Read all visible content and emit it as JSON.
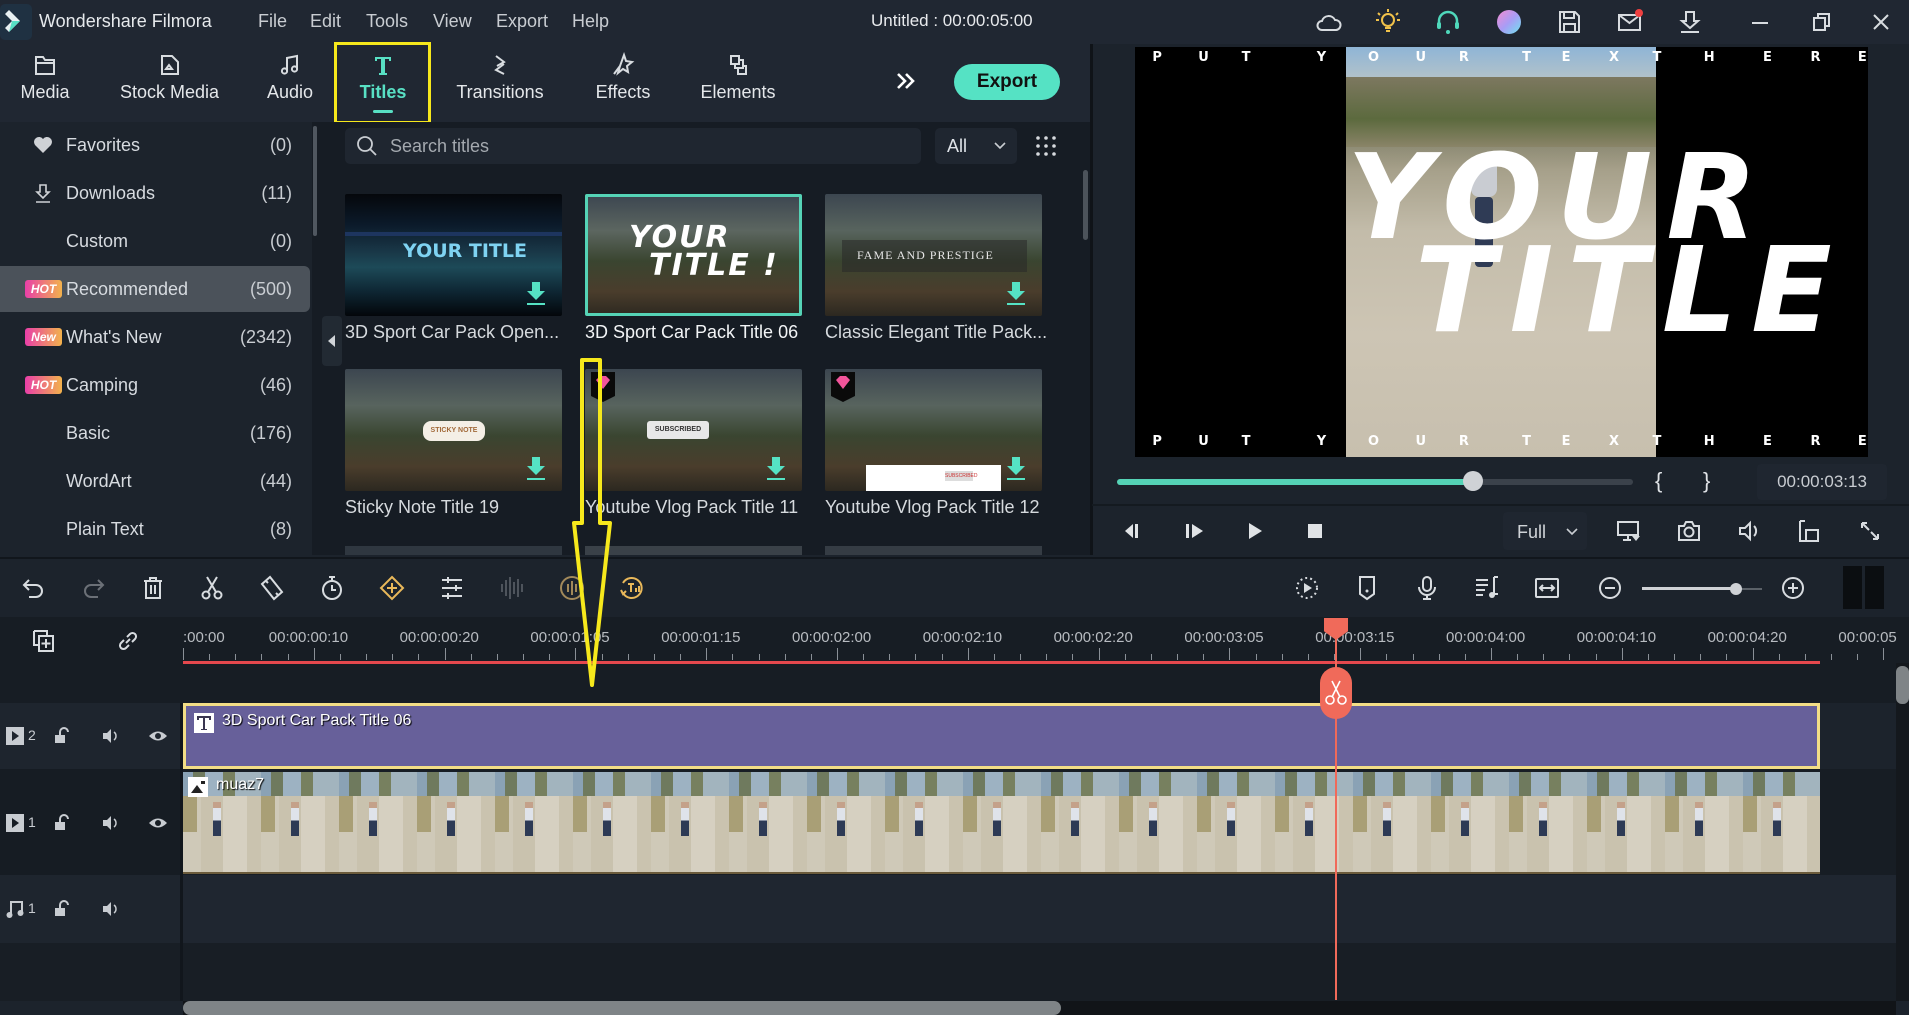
{
  "titlebar": {
    "app_name": "Wondershare Filmora",
    "menu": [
      "File",
      "Edit",
      "Tools",
      "View",
      "Export",
      "Help"
    ],
    "document_title": "Untitled : 00:00:05:00",
    "icons": [
      "cloud-icon",
      "lightbulb-icon",
      "headset-icon",
      "avatar-icon",
      "save-icon",
      "mail-icon",
      "download-icon",
      "minimize-icon",
      "restore-icon",
      "close-icon"
    ]
  },
  "tabs": [
    {
      "label": "Media",
      "icon": "folder-icon"
    },
    {
      "label": "Stock Media",
      "icon": "stock-media-icon"
    },
    {
      "label": "Audio",
      "icon": "music-note-icon"
    },
    {
      "label": "Titles",
      "icon": "text-t-icon",
      "active": true
    },
    {
      "label": "Transitions",
      "icon": "transitions-icon"
    },
    {
      "label": "Effects",
      "icon": "effects-star-icon"
    },
    {
      "label": "Elements",
      "icon": "elements-icon"
    }
  ],
  "toolbar": {
    "more_label": "»",
    "export_label": "Export"
  },
  "colors": {
    "accent": "#55e2c4",
    "highlight_box": "#f6e81c",
    "playhead": "#f06a5a",
    "title_clip": "#67609a",
    "clip_border": "#f3de86",
    "timeline_red": "#e5484d"
  },
  "sidebar": {
    "items": [
      {
        "label": "Favorites",
        "count": "(0)",
        "icon": "heart-icon"
      },
      {
        "label": "Downloads",
        "count": "(11)",
        "icon": "download-icon"
      },
      {
        "label": "Custom",
        "count": "(0)"
      },
      {
        "label": "Recommended",
        "count": "(500)",
        "badge": "HOT",
        "selected": true
      },
      {
        "label": "What's New",
        "count": "(2342)",
        "badge": "New"
      },
      {
        "label": "Camping",
        "count": "(46)",
        "badge": "HOT"
      },
      {
        "label": "Basic",
        "count": "(176)"
      },
      {
        "label": "WordArt",
        "count": "(44)"
      },
      {
        "label": "Plain Text",
        "count": "(8)"
      }
    ]
  },
  "library": {
    "search_placeholder": "Search titles",
    "filter_value": "All",
    "thumbnails": [
      {
        "label": "3D Sport Car Pack Open...",
        "overlay": "YOUR TITLE",
        "download": true
      },
      {
        "label": "3D Sport Car Pack Title 06",
        "overlay_line1": "YOUR",
        "overlay_line2": "TITLE !",
        "selected": true
      },
      {
        "label": "Classic Elegant Title Pack...",
        "overlay": "FAME AND PRESTIGE",
        "download": true
      },
      {
        "label": "Sticky Note Title 19",
        "overlay": "STICKY NOTE",
        "download": true
      },
      {
        "label": "Youtube Vlog Pack Title 11",
        "overlay": "SUBSCRIBED",
        "premium": true,
        "download": true
      },
      {
        "label": "Youtube Vlog Pack Title 12",
        "overlay": "SUBSCRIBED",
        "premium": true,
        "download": true
      }
    ]
  },
  "preview": {
    "top_text": [
      "P",
      "U",
      "T",
      "Y",
      "O",
      "U",
      "R",
      "T",
      "E",
      "X",
      "T",
      "H",
      "E",
      "R",
      "E"
    ],
    "bottom_text": [
      "P",
      "U",
      "T",
      "Y",
      "O",
      "U",
      "R",
      "T",
      "E",
      "X",
      "T",
      "H",
      "E",
      "R",
      "E"
    ],
    "title_line1": "YOUR",
    "title_line2": "TITLE",
    "title_excl": "!",
    "progress_fraction": 0.69,
    "mark_in": "{",
    "mark_out": "}",
    "timecode": "00:00:03:13",
    "quality": "Full"
  },
  "timeline": {
    "ruler_labels": [
      ":00:00",
      "00:00:00:10",
      "00:00:00:20",
      "00:00:01:05",
      "00:00:01:15",
      "00:00:02:00",
      "00:00:02:10",
      "00:00:02:20",
      "00:00:03:05",
      "00:00:03:15",
      "00:00:04:00",
      "00:00:04:10",
      "00:00:04:20",
      "00:00:05"
    ],
    "tracks": [
      {
        "type": "video",
        "number": "2",
        "clip": "3D Sport Car Pack Title 06"
      },
      {
        "type": "video",
        "number": "1",
        "clip": "muaz7"
      },
      {
        "type": "audio",
        "number": "1"
      }
    ],
    "zoom_fraction": 0.78
  }
}
